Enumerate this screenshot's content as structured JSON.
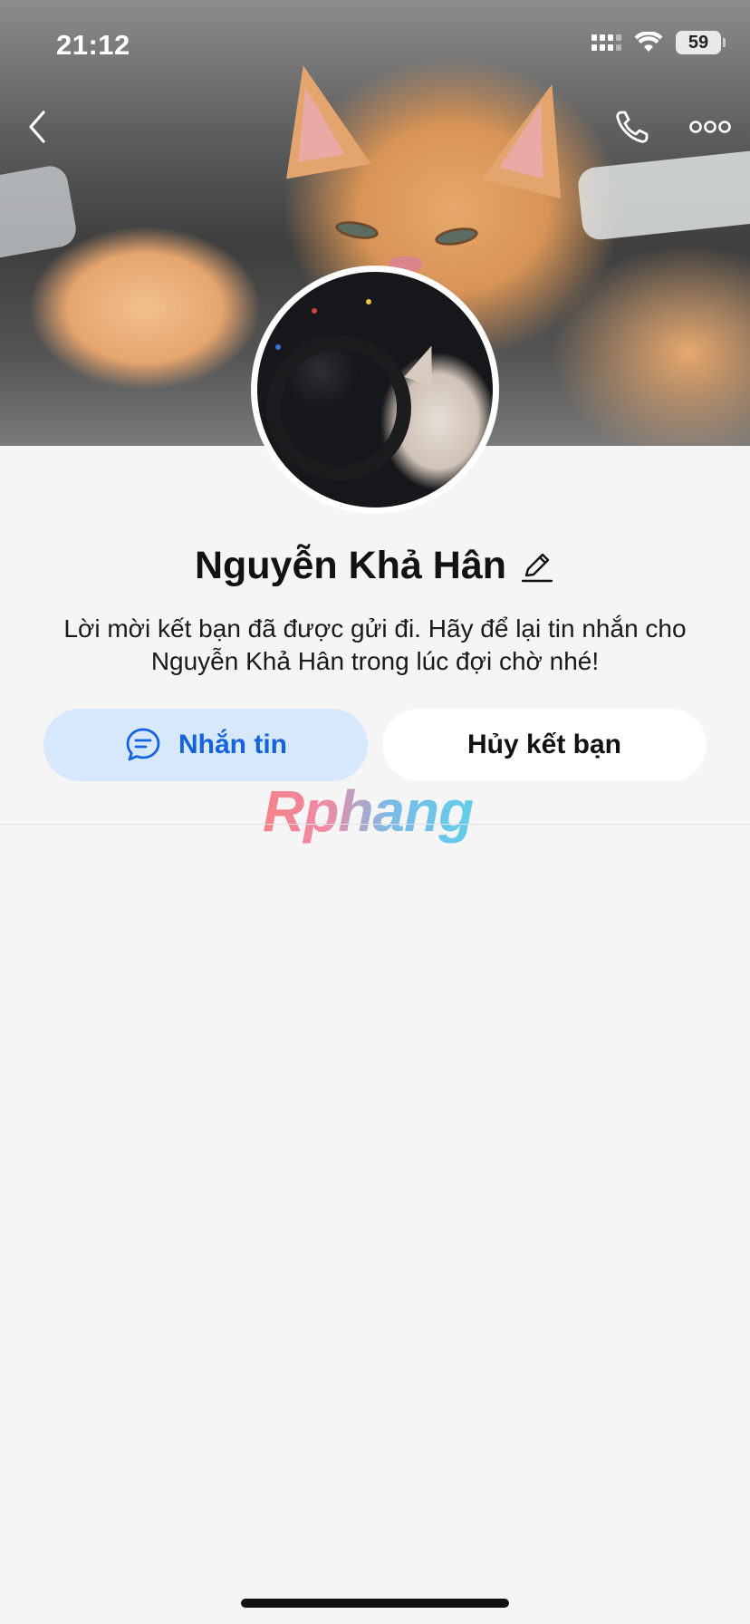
{
  "status_bar": {
    "time": "21:12",
    "battery": "59"
  },
  "profile": {
    "name": "Nguyễn Khả Hân",
    "notice": "Lời mời kết bạn đã được gửi đi. Hãy để lại tin nhắn cho Nguyễn Khả Hân trong lúc đợi chờ nhé!"
  },
  "actions": {
    "message_label": "Nhắn tin",
    "cancel_label": "Hủy kết bạn"
  },
  "watermark": "Rphang",
  "icons": {
    "back": "chevron-left-icon",
    "call": "phone-icon",
    "more": "more-dots-icon",
    "edit": "pencil-icon",
    "message": "chat-bubble-icon"
  },
  "colors": {
    "accent_blue": "#1463de",
    "message_button_bg": "#d7e8fc",
    "background": "#f5f5f6"
  }
}
